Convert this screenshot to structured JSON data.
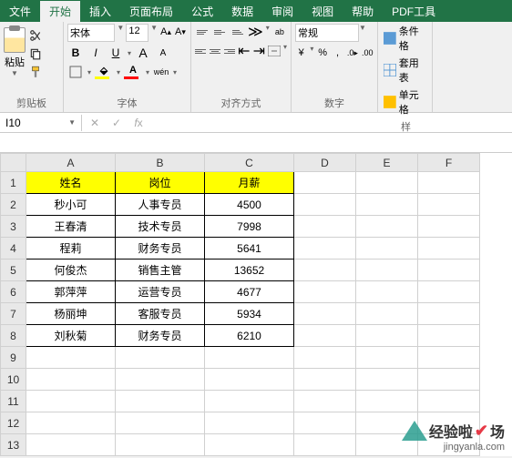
{
  "tabs": [
    "文件",
    "开始",
    "插入",
    "页面布局",
    "公式",
    "数据",
    "审阅",
    "视图",
    "帮助",
    "PDF工具"
  ],
  "clipboard": {
    "paste": "粘贴",
    "label": "剪贴板"
  },
  "font": {
    "name": "宋体",
    "size": "12",
    "label": "字体",
    "wen": "wén"
  },
  "align": {
    "label": "对齐方式"
  },
  "number": {
    "format": "常规",
    "label": "数字"
  },
  "styles": {
    "cond": "条件格",
    "table": "套用表",
    "cell": "单元格",
    "label": "样"
  },
  "cell_ref": "I10",
  "columns": [
    "A",
    "B",
    "C",
    "D",
    "E",
    "F"
  ],
  "headers": [
    "姓名",
    "岗位",
    "月薪"
  ],
  "rows": [
    [
      "秒小可",
      "人事专员",
      "4500"
    ],
    [
      "王春清",
      "技术专员",
      "7998"
    ],
    [
      "程莉",
      "财务专员",
      "5641"
    ],
    [
      "何俊杰",
      "销售主管",
      "13652"
    ],
    [
      "郭萍萍",
      "运营专员",
      "4677"
    ],
    [
      "杨丽坤",
      "客服专员",
      "5934"
    ],
    [
      "刘秋菊",
      "财务专员",
      "6210"
    ]
  ],
  "watermark": {
    "brand1": "经验啦",
    "brand2": "场",
    "url": "jingyanla.com"
  }
}
